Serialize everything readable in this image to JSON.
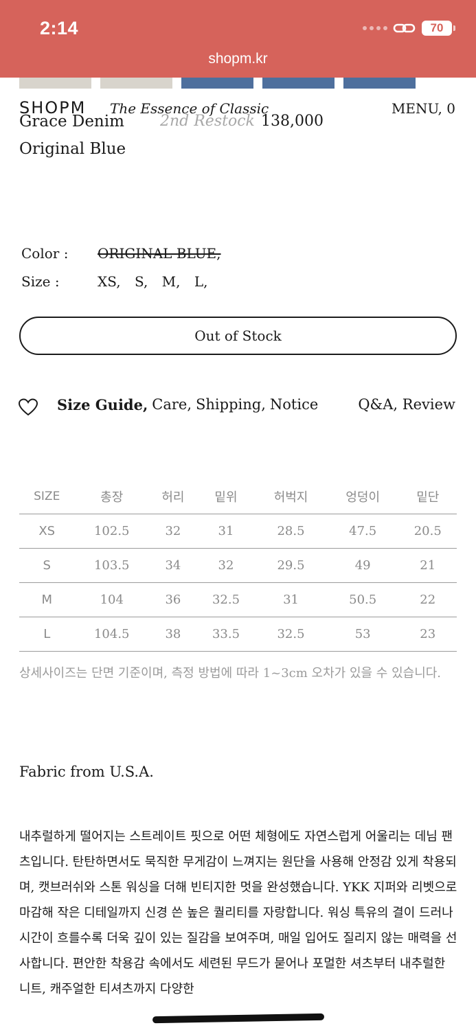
{
  "status": {
    "time": "2:14",
    "battery": "70"
  },
  "browser": {
    "url": "shopm.kr"
  },
  "header": {
    "logo": "SHOPM",
    "tagline": "The Essence of Classic",
    "menu": "MENU, 0"
  },
  "product": {
    "name": "Grace Denim",
    "restock": "2nd Restock",
    "price": "138,000",
    "variant": "Original Blue",
    "color_label": "Color :",
    "color_value": "ORIGINAL BLUE,",
    "size_label": "Size :",
    "sizes": [
      "XS,",
      "S,",
      "M,",
      "L,"
    ],
    "button": "Out of Stock"
  },
  "tabs": {
    "size_guide": "Size Guide,",
    "care": "Care,",
    "shipping": "Shipping,",
    "notice": "Notice",
    "qa_review": "Q&A, Review"
  },
  "size_table": {
    "headers": [
      "SIZE",
      "총장",
      "허리",
      "밑위",
      "허벅지",
      "엉덩이",
      "밑단"
    ],
    "rows": [
      [
        "XS",
        "102.5",
        "32",
        "31",
        "28.5",
        "47.5",
        "20.5"
      ],
      [
        "S",
        "103.5",
        "34",
        "32",
        "29.5",
        "49",
        "21"
      ],
      [
        "M",
        "104",
        "36",
        "32.5",
        "31",
        "50.5",
        "22"
      ],
      [
        "L",
        "104.5",
        "38",
        "33.5",
        "32.5",
        "53",
        "23"
      ]
    ],
    "note": "상세사이즈는 단면 기준이며, 측정 방법에 따라 1~3cm 오차가 있을 수 있습니다."
  },
  "fabric": "Fabric from U.S.A.",
  "description": "내추럴하게 떨어지는 스트레이트 핏으로 어떤 체형에도 자연스럽게 어울리는 데님 팬츠입니다. 탄탄하면서도 묵직한 무게감이 느껴지는 원단을 사용해 안정감 있게 착용되며, 캣브러쉬와 스톤 워싱을 더해 빈티지한 멋을 완성했습니다. YKK 지퍼와 리벳으로 마감해 작은 디테일까지 신경 쓴 높은 퀄리티를 자랑합니다. 워싱 특유의 결이 드러나 시간이 흐를수록 더욱 깊이 있는 질감을 보여주며, 매일 입어도 질리지 않는 매력을 선사합니다. 편안한 착용감 속에서도 세련된 무드가 묻어나 포멀한 셔츠부터 내추럴한 니트, 캐주얼한 티셔츠까지 다양한",
  "colors": {
    "accent": "#d6635b",
    "thumb_beige": "#d8d4cc",
    "thumb_denim": "#4e6f9d"
  },
  "icons": [
    "link-icon",
    "heart-icon"
  ]
}
